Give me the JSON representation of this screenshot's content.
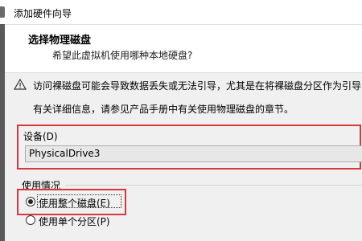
{
  "window": {
    "title": "添加硬件向导"
  },
  "header": {
    "title": "选择物理磁盘",
    "subtitle": "希望此虚拟机使用哪种本地硬盘?"
  },
  "warning": {
    "icon": "warning-icon",
    "line1": "访问裸磁盘可能会导致数据丢失或无法引导，尤其是在将裸磁盘分区作为引导",
    "line2": "有关详细信息，请参见产品手册中有关使用物理磁盘的章节。"
  },
  "device": {
    "label": "设备(D)",
    "selected": "PhysicalDrive3"
  },
  "usage": {
    "label": "使用情况",
    "options": [
      {
        "label": "使用整个磁盘(E)",
        "checked": true
      },
      {
        "label": "使用单个分区(P)",
        "checked": false
      }
    ]
  },
  "colors": {
    "highlight_border": "#d9383a",
    "window_bg": "#f0f0f0",
    "header_bg": "#ffffff"
  }
}
